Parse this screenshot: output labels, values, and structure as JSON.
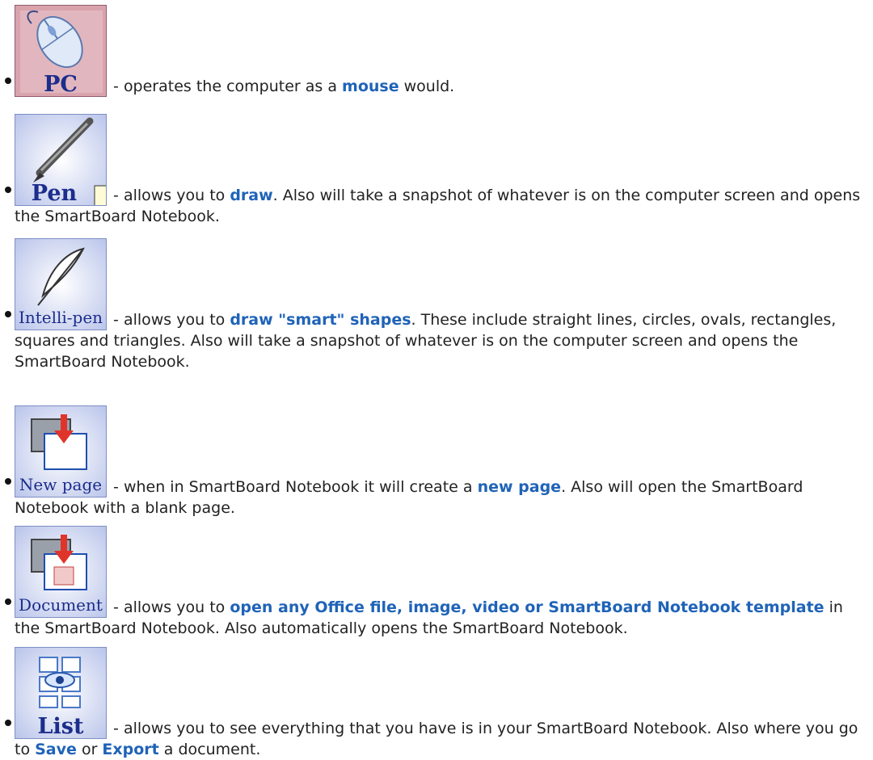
{
  "items": [
    {
      "icon": {
        "name": "mouse-icon",
        "label": "PC"
      },
      "dash": " - ",
      "pre": "operates the computer as a ",
      "link1": "mouse",
      "mid": " would.",
      "link2": "",
      "post": ""
    },
    {
      "icon": {
        "name": "pen-icon",
        "label": "Pen"
      },
      "dash": " - ",
      "pre": "allows you to ",
      "link1": "draw",
      "mid": ". Also will take a snapshot of whatever is on the computer screen and opens the SmartBoard Notebook.",
      "link2": "",
      "post": ""
    },
    {
      "icon": {
        "name": "feather-pen-icon",
        "label": "Intelli-pen"
      },
      "dash": " - ",
      "pre": "allows you to ",
      "link1": "draw \"smart\" shapes",
      "mid": ". These include straight lines, circles, ovals, rectangles, squares and triangles. Also will take a snapshot of whatever is on the computer screen and opens the SmartBoard Notebook.",
      "link2": "",
      "post": ""
    },
    {
      "icon": {
        "name": "new-page-icon",
        "label": "New page"
      },
      "dash": " - ",
      "pre": "when in SmartBoard Notebook it will create a ",
      "link1": "new page",
      "mid": ". Also will open the SmartBoard Notebook with a blank page.",
      "link2": "",
      "post": ""
    },
    {
      "icon": {
        "name": "document-icon",
        "label": "Document"
      },
      "dash": " - ",
      "pre": "allows you to ",
      "link1": "open any Office file, image, video or SmartBoard Notebook template",
      "mid": " in the SmartBoard Notebook. Also automatically opens the SmartBoard Notebook.",
      "link2": "",
      "post": ""
    },
    {
      "icon": {
        "name": "list-icon",
        "label": "List"
      },
      "dash": " - ",
      "pre": "allows you to see everything that you have is in your SmartBoard Notebook. Also where you go to ",
      "link1": "Save",
      "mid": " or ",
      "link2": "Export",
      "post": " a document."
    }
  ],
  "colors": {
    "link": "#1f63b8",
    "icon_label": "#1c2d8c",
    "text": "#222222"
  }
}
